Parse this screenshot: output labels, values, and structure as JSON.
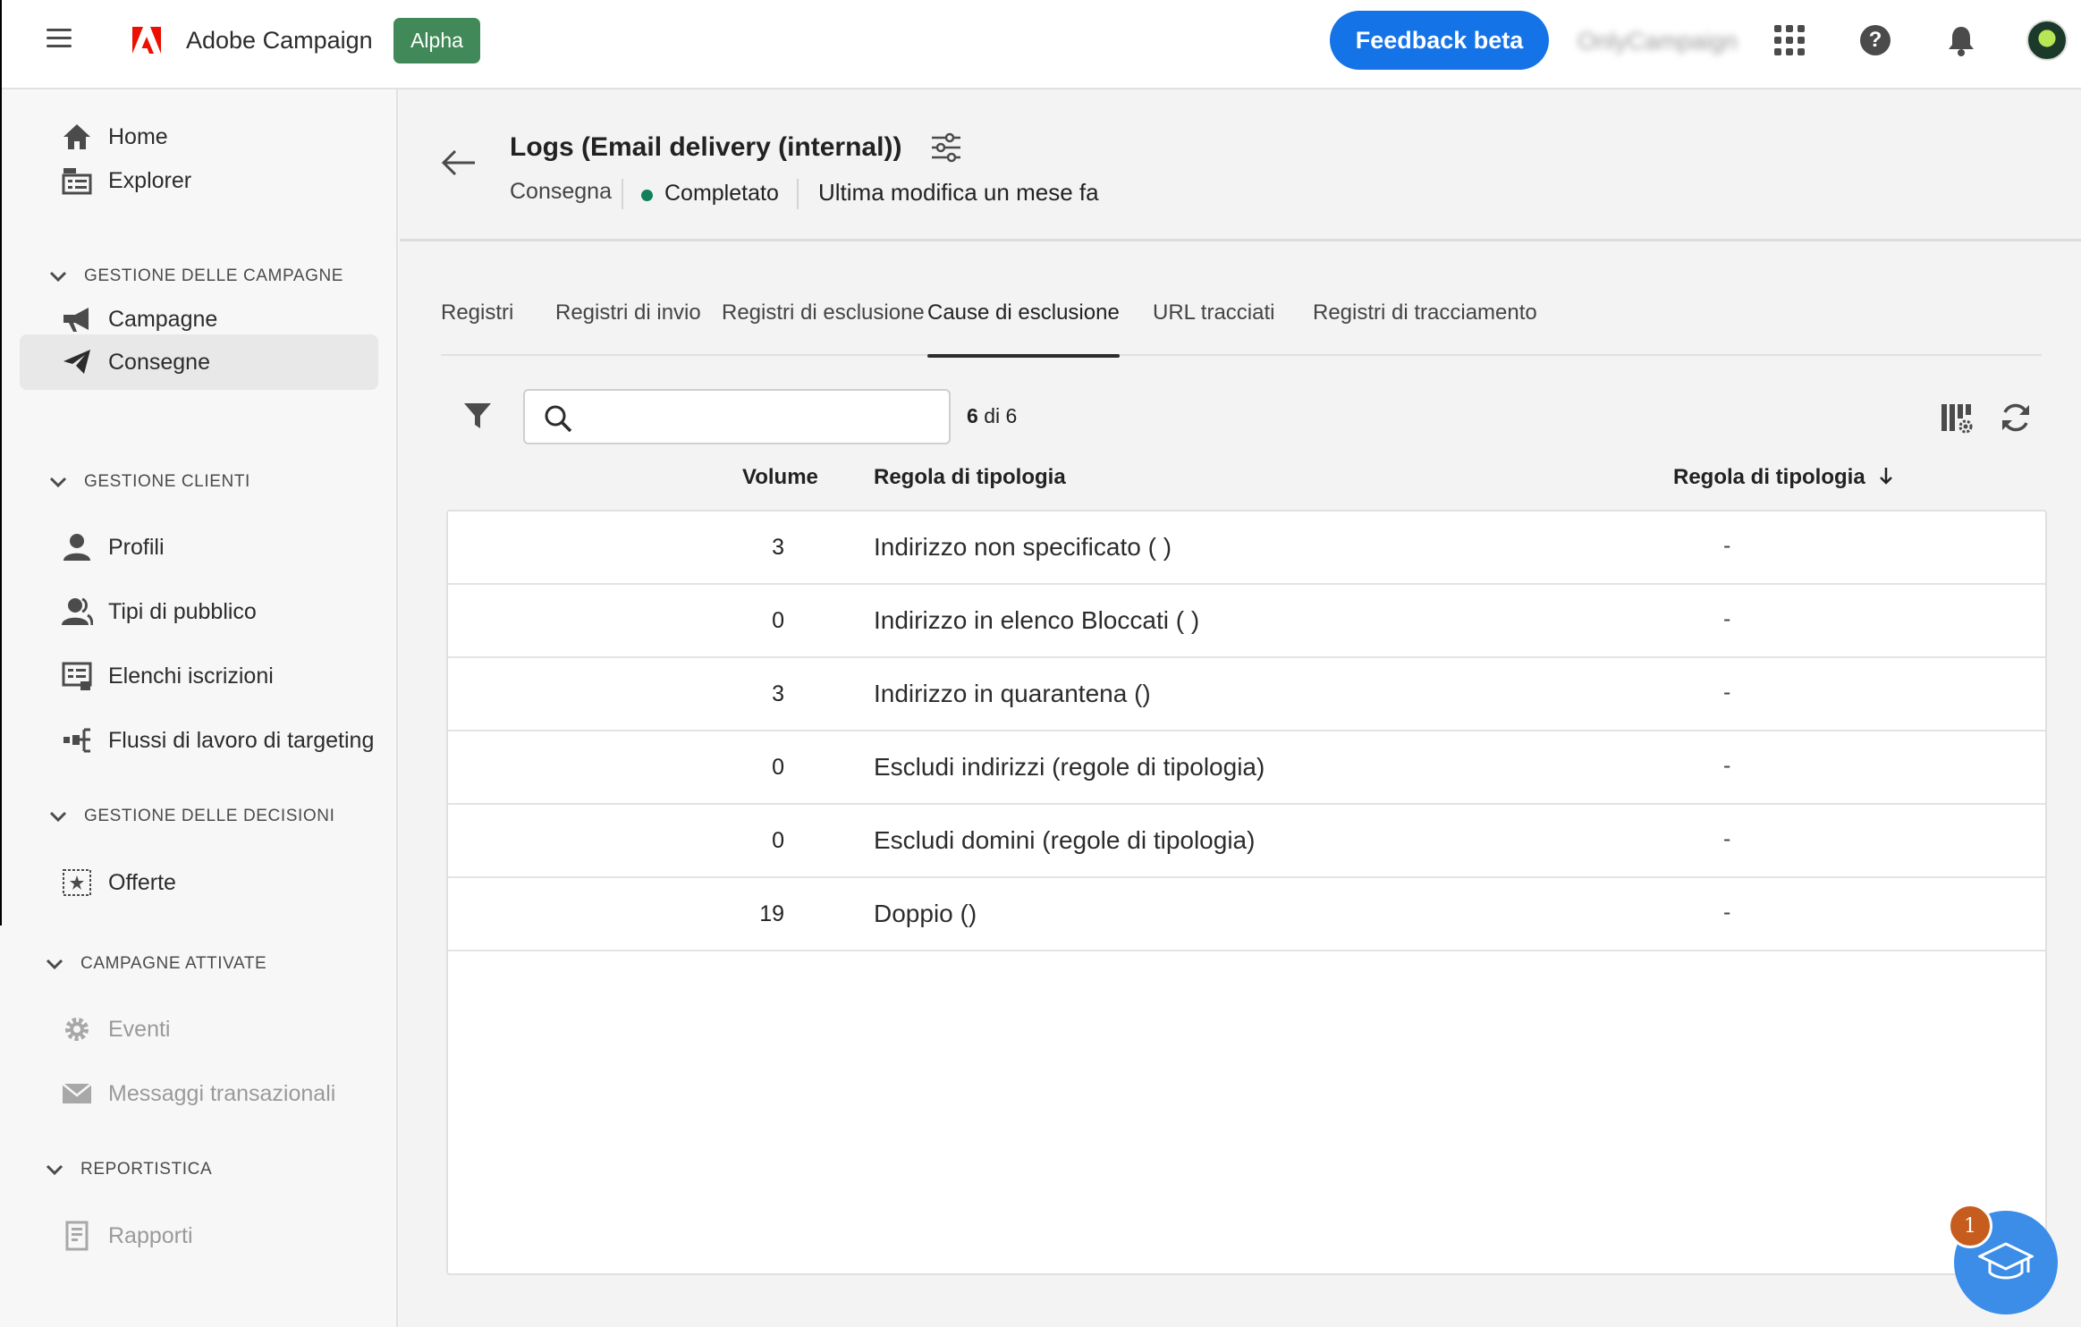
{
  "topbar": {
    "app_name": "Adobe Campaign",
    "badge": "Alpha",
    "feedback_label": "Feedback beta",
    "org_name": "OnlyCampaign",
    "icons": [
      "menu-icon",
      "adobe-logo",
      "apps-icon",
      "help-icon",
      "bell-icon",
      "avatar"
    ]
  },
  "sidebar": {
    "items_top": [
      {
        "label": "Home",
        "icon": "home-icon"
      },
      {
        "label": "Explorer",
        "icon": "explorer-icon"
      }
    ],
    "sections": [
      {
        "title": "GESTIONE DELLE CAMPAGNE",
        "items": [
          {
            "label": "Campagne",
            "icon": "megaphone-icon"
          },
          {
            "label": "Consegne",
            "icon": "send-icon",
            "active": true
          }
        ]
      },
      {
        "title": "GESTIONE CLIENTI",
        "items": [
          {
            "label": "Profili",
            "icon": "user-icon"
          },
          {
            "label": "Tipi di pubblico",
            "icon": "users-icon"
          },
          {
            "label": "Elenchi iscrizioni",
            "icon": "list-icon"
          },
          {
            "label": "Flussi di lavoro di targeting",
            "icon": "workflow-icon"
          }
        ]
      },
      {
        "title": "GESTIONE DELLE DECISIONI",
        "items": [
          {
            "label": "Offerte",
            "icon": "offer-icon"
          }
        ]
      },
      {
        "title": "CAMPAGNE ATTIVATE",
        "items": [
          {
            "label": "Eventi",
            "icon": "gear-icon",
            "disabled": true
          },
          {
            "label": "Messaggi transazionali",
            "icon": "mail-icon",
            "disabled": true
          }
        ]
      },
      {
        "title": "REPORTISTICA",
        "items": [
          {
            "label": "Rapporti",
            "icon": "report-icon",
            "disabled": true
          }
        ]
      }
    ]
  },
  "header": {
    "title": "Logs (Email delivery (internal))",
    "type": "Consegna",
    "status": "Completato",
    "status_color": "#12805c",
    "modified": "Ultima modifica un mese fa"
  },
  "tabs": [
    {
      "label": "Registri"
    },
    {
      "label": "Registri di invio"
    },
    {
      "label": "Registri di esclusione"
    },
    {
      "label": "Cause di esclusione",
      "active": true
    },
    {
      "label": "URL tracciati"
    },
    {
      "label": "Registri di tracciamento"
    }
  ],
  "toolbar": {
    "search_placeholder": "",
    "count_current": "6",
    "count_sep": "di",
    "count_total": "6"
  },
  "table": {
    "columns": [
      "Volume",
      "Regola di tipologia",
      "Regola di tipologia"
    ],
    "sort_icon": "arrow-down-icon",
    "rows": [
      {
        "volume": "3",
        "reason": "Indirizzo non specificato ( )",
        "rule": "-"
      },
      {
        "volume": "0",
        "reason": "Indirizzo in elenco Bloccati ( )",
        "rule": "-"
      },
      {
        "volume": "3",
        "reason": "Indirizzo in quarantena ()",
        "rule": "-"
      },
      {
        "volume": "0",
        "reason": "Escludi indirizzi (regole di tipologia)",
        "rule": "-"
      },
      {
        "volume": "0",
        "reason": "Escludi domini (regole di tipologia)",
        "rule": "-"
      },
      {
        "volume": "19",
        "reason": "Doppio ()",
        "rule": "-"
      }
    ]
  },
  "learn": {
    "badge_count": "1",
    "icon": "graduation-cap-icon"
  },
  "colors": {
    "accent": "#1473e6",
    "alpha": "#2d7d46",
    "brand_red": "#eb1000"
  }
}
